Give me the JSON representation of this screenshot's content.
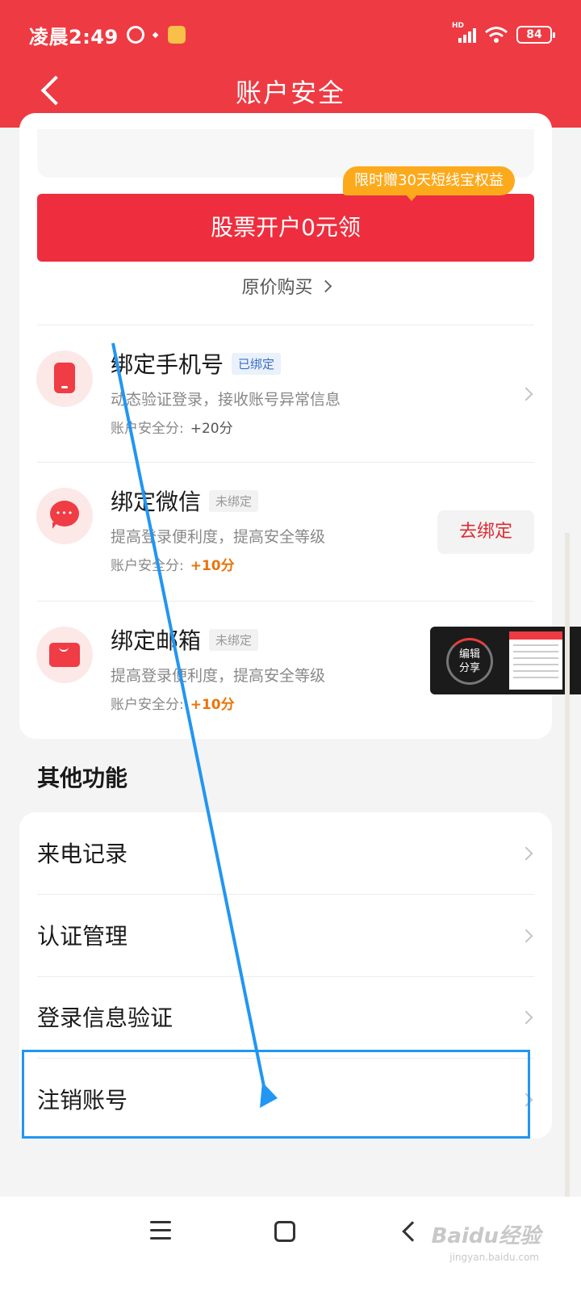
{
  "status_bar": {
    "time": "凌晨2:49",
    "carrier_badge": "HD",
    "battery": "84"
  },
  "header": {
    "title": "账户安全"
  },
  "promo": {
    "badge": "限时赠30天短线宝权益",
    "cta": "股票开户0元领",
    "original_price": "原价购买"
  },
  "bindings": [
    {
      "title": "绑定手机号",
      "tag": "已绑定",
      "desc": "动态验证登录，接收账号异常信息",
      "score_label": "账户安全分:",
      "score": "+20分"
    },
    {
      "title": "绑定微信",
      "tag": "未绑定",
      "desc": "提高登录便利度，提高安全等级",
      "score_label": "账户安全分:",
      "score": "+10分",
      "action": "去绑定"
    },
    {
      "title": "绑定邮箱",
      "tag": "未绑定",
      "desc": "提高登录便利度，提高安全等级",
      "score_label": "账户安全分:",
      "score": "+10分"
    }
  ],
  "share_widget": {
    "line1": "编辑",
    "line2": "分享"
  },
  "other": {
    "title": "其他功能",
    "items": [
      "来电记录",
      "认证管理",
      "登录信息验证",
      "注销账号"
    ]
  },
  "watermark": {
    "text": "Baidu经验",
    "sub": "jingyan.baidu.com"
  },
  "colors": {
    "brand": "#ee3a42",
    "highlight": "#2196f3",
    "score": "#e8750b"
  }
}
